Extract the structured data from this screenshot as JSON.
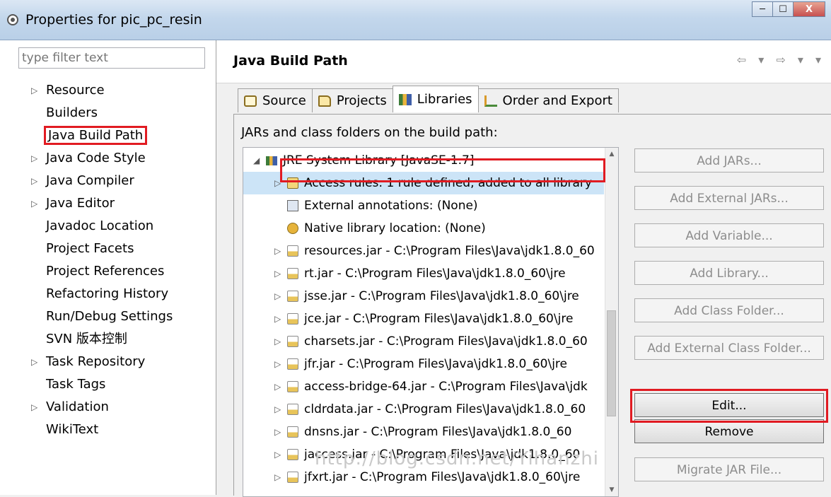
{
  "window": {
    "title": "Properties for pic_pc_resin",
    "controls": {
      "minimize": "─",
      "maximize": "☐",
      "close": "X"
    }
  },
  "filter": {
    "placeholder": "type filter text"
  },
  "nav": {
    "items": [
      {
        "label": "Resource",
        "expandable": true
      },
      {
        "label": "Builders",
        "expandable": false
      },
      {
        "label": "Java Build Path",
        "expandable": false,
        "selected": true
      },
      {
        "label": "Java Code Style",
        "expandable": true
      },
      {
        "label": "Java Compiler",
        "expandable": true
      },
      {
        "label": "Java Editor",
        "expandable": true
      },
      {
        "label": "Javadoc Location",
        "expandable": false
      },
      {
        "label": "Project Facets",
        "expandable": false
      },
      {
        "label": "Project References",
        "expandable": false
      },
      {
        "label": "Refactoring History",
        "expandable": false
      },
      {
        "label": "Run/Debug Settings",
        "expandable": false
      },
      {
        "label": "SVN 版本控制",
        "expandable": false
      },
      {
        "label": "Task Repository",
        "expandable": true
      },
      {
        "label": "Task Tags",
        "expandable": false
      },
      {
        "label": "Validation",
        "expandable": true
      },
      {
        "label": "WikiText",
        "expandable": false
      }
    ]
  },
  "page": {
    "title": "Java Build Path",
    "nav_arrows": "⇦ ▾ ⇨ ▾ ▾"
  },
  "tabs": [
    {
      "label": "Source",
      "icon": "source-icon"
    },
    {
      "label": "Projects",
      "icon": "folder-icon"
    },
    {
      "label": "Libraries",
      "icon": "library-icon",
      "active": true
    },
    {
      "label": "Order and Export",
      "icon": "order-icon"
    }
  ],
  "libraries": {
    "description": "JARs and class folders on the build path:",
    "tree": [
      {
        "text": "JRE System Library [JavaSE-1.7]",
        "level": 0,
        "arrow": "◢",
        "icon": "jre-icon"
      },
      {
        "text": "Access rules: 1 rule defined, added to all library",
        "level": 1,
        "arrow": "▷",
        "icon": "access-rule-icon",
        "selected": true
      },
      {
        "text": "External annotations: (None)",
        "level": 1,
        "arrow": "",
        "icon": "annotation-icon"
      },
      {
        "text": "Native library location: (None)",
        "level": 1,
        "arrow": "",
        "icon": "native-icon"
      },
      {
        "text": "resources.jar - C:\\Program Files\\Java\\jdk1.8.0_60",
        "level": 1,
        "arrow": "▷",
        "icon": "jar-icon"
      },
      {
        "text": "rt.jar - C:\\Program Files\\Java\\jdk1.8.0_60\\jre",
        "level": 1,
        "arrow": "▷",
        "icon": "jar-icon"
      },
      {
        "text": "jsse.jar - C:\\Program Files\\Java\\jdk1.8.0_60\\jre",
        "level": 1,
        "arrow": "▷",
        "icon": "jar-icon"
      },
      {
        "text": "jce.jar - C:\\Program Files\\Java\\jdk1.8.0_60\\jre",
        "level": 1,
        "arrow": "▷",
        "icon": "jar-icon"
      },
      {
        "text": "charsets.jar - C:\\Program Files\\Java\\jdk1.8.0_60",
        "level": 1,
        "arrow": "▷",
        "icon": "jar-icon"
      },
      {
        "text": "jfr.jar - C:\\Program Files\\Java\\jdk1.8.0_60\\jre",
        "level": 1,
        "arrow": "▷",
        "icon": "jar-icon"
      },
      {
        "text": "access-bridge-64.jar - C:\\Program Files\\Java\\jdk",
        "level": 1,
        "arrow": "▷",
        "icon": "jar-icon"
      },
      {
        "text": "cldrdata.jar - C:\\Program Files\\Java\\jdk1.8.0_60",
        "level": 1,
        "arrow": "▷",
        "icon": "jar-icon"
      },
      {
        "text": "dnsns.jar - C:\\Program Files\\Java\\jdk1.8.0_60",
        "level": 1,
        "arrow": "▷",
        "icon": "jar-icon"
      },
      {
        "text": "jaccess.jar - C:\\Program Files\\Java\\jdk1.8.0_60",
        "level": 1,
        "arrow": "▷",
        "icon": "jar-icon"
      },
      {
        "text": "jfxrt.jar - C:\\Program Files\\Java\\jdk1.8.0_60\\jre",
        "level": 1,
        "arrow": "▷",
        "icon": "jar-icon"
      }
    ],
    "buttons": [
      {
        "label": "Add JARs...",
        "enabled": false
      },
      {
        "label": "Add External JARs...",
        "enabled": false
      },
      {
        "label": "Add Variable...",
        "enabled": false
      },
      {
        "label": "Add Library...",
        "enabled": false
      },
      {
        "label": "Add Class Folder...",
        "enabled": false
      },
      {
        "label": "Add External Class Folder...",
        "enabled": false
      },
      {
        "label": "Edit...",
        "enabled": true
      },
      {
        "label": "Remove",
        "enabled": true
      },
      {
        "label": "Migrate JAR File...",
        "enabled": false
      }
    ]
  },
  "watermark": "http://blog.csdn.net/Yihanzhi",
  "colors": {
    "highlight": "#e11b22",
    "selection": "#cce4f7"
  }
}
